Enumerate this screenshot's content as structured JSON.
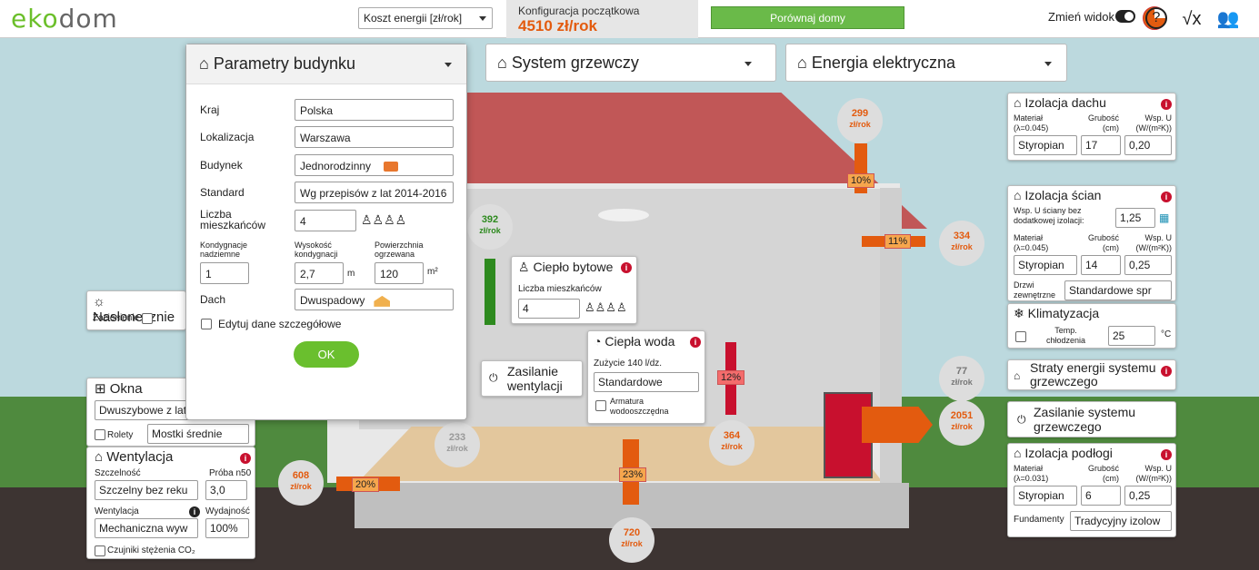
{
  "top": {
    "logo_a": "ek",
    "logo_o": "o",
    "logo_b": "dom",
    "cost_select": "Koszt energii [zł/rok]",
    "config_title": "Konfiguracja początkowa",
    "config_value": "4510 zł/rok",
    "compare_btn": "Porównaj domy",
    "view_label": "Zmień widok"
  },
  "tabs": {
    "heating": "System grzewczy",
    "electric": "Energia elektryczna"
  },
  "modal": {
    "title": "Parametry budynku",
    "country_label": "Kraj",
    "country": "Polska",
    "location_label": "Lokalizacja",
    "location": "Warszawa",
    "building_label": "Budynek",
    "building": "Jednorodzinny",
    "standard_label": "Standard",
    "standard": "Wg przepisów z lat 2014-2016",
    "residents_label_1": "Liczba",
    "residents_label_2": "mieszkańców",
    "residents": "4",
    "floors_label_1": "Kondygnacje",
    "floors_label_2": "nadziemne",
    "floors": "1",
    "height_label_1": "Wysokość",
    "height_label_2": "kondygnacji",
    "height": "2,7",
    "height_unit": "m",
    "area_label_1": "Powierzchnia",
    "area_label_2": "ogrzewana",
    "area": "120",
    "area_unit": "m²",
    "roof_label": "Dach",
    "roof": "Dwuspadowy",
    "detail_label": "Edytuj dane szczegółowe",
    "ok": "OK"
  },
  "left": {
    "sun_title": "Nasłonecznie",
    "shade": "Zacienienie",
    "windows_title": "Okna",
    "windows": "Dwuszybowe z lat",
    "blinds": "Rolety",
    "bridges": "Mostki średnie",
    "vent_title": "Wentylacja",
    "tight_label": "Szczelność",
    "test_label": "Próba n50",
    "tight": "Szczelny bez reku",
    "test": "3,0",
    "vent_label": "Wentylacja",
    "eff_label": "Wydajność",
    "vent": "Mechaniczna wyw",
    "eff": "100%",
    "co2": "Czujniki stężenia CO₂"
  },
  "center": {
    "heat_title": "Ciepło bytowe",
    "heat_res_label": "Liczba mieszkańców",
    "heat_res": "4",
    "vent_power": "Zasilanie wentylacji",
    "water_title": "Ciepła woda",
    "water_use": "Zużycie 140 l/dz.",
    "water": "Standardowe",
    "fittings_1": "Armatura",
    "fittings_2": "wodooszczędna"
  },
  "right": {
    "roof_ins_title": "Izolacja dachu",
    "mat_label": "Materiał",
    "mat_lambda_045": "(λ=0.045)",
    "thick_label": "Grubość",
    "thick_unit": "(cm)",
    "u_label": "Wsp. U",
    "u_unit": "(W/(m²K))",
    "roof_mat": "Styropian",
    "roof_thick": "17",
    "roof_u": "0,20",
    "wall_ins_title": "Izolacja ścian",
    "wall_u_base_1": "Wsp. U ściany bez",
    "wall_u_base_2": "dodatkowej izolacji:",
    "wall_u_base": "1,25",
    "wall_mat": "Styropian",
    "wall_thick": "14",
    "wall_u": "0,25",
    "doors_1": "Drzwi",
    "doors_2": "zewnętrzne",
    "doors": "Standardowe spr",
    "ac_title": "Klimatyzacja",
    "ac_temp_1": "Temp.",
    "ac_temp_2": "chłodzenia",
    "ac_temp": "25",
    "ac_unit": "°C",
    "loss_title": "Straty energii systemu grzewczego",
    "heat_power": "Zasilanie systemu grzewczego",
    "floor_ins_title": "Izolacja podłogi",
    "mat_lambda_031": "(λ=0.031)",
    "floor_mat": "Styropian",
    "floor_thick": "6",
    "floor_u": "0,25",
    "found_label": "Fundamenty",
    "found": "Tradycyjny izolow"
  },
  "flows": [
    {
      "value": "299",
      "unit": "zł/rok"
    },
    {
      "value": "334",
      "unit": "zł/rok"
    },
    {
      "value": "392",
      "unit": "zł/rok"
    },
    {
      "value": "77",
      "unit": "zł/rok"
    },
    {
      "value": "2051",
      "unit": "zł/rok"
    },
    {
      "value": "233",
      "unit": "zł/rok"
    },
    {
      "value": "364",
      "unit": "zł/rok"
    },
    {
      "value": "608",
      "unit": "zł/rok"
    },
    {
      "value": "720",
      "unit": "zł/rok"
    }
  ],
  "percents": {
    "roof": "10%",
    "wall": "11%",
    "water": "12%",
    "vent": "20%",
    "floor": "23%"
  }
}
